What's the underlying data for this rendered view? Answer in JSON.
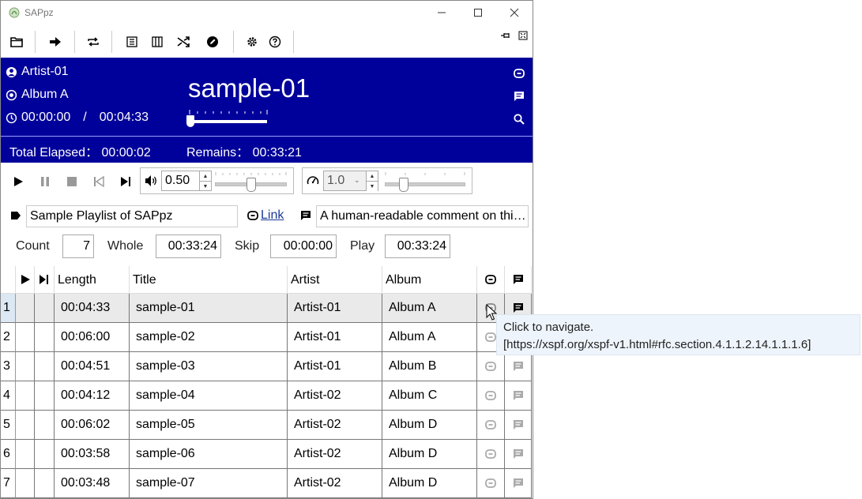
{
  "window": {
    "title": "SAPpz"
  },
  "window_controls": {
    "minimize": "—",
    "maximize": "☐",
    "close": "✕"
  },
  "toolbar": {
    "icons": [
      "folder-icon",
      "arrow-right-icon",
      "repeat-icon",
      "list-icon",
      "columns-icon",
      "shuffle-icon",
      "edit-icon",
      "gear-icon",
      "help-icon",
      "pin-icon",
      "fullscreen-icon"
    ]
  },
  "now_playing": {
    "artist": "Artist-01",
    "album": "Album A",
    "current_time": "00:00:00",
    "separator": "/",
    "total_time": "00:04:33",
    "title": "sample-01",
    "progress": 0.0
  },
  "elapsed": {
    "label": "Total Elapsed：",
    "value": "00:00:02"
  },
  "remains": {
    "label": "Remains：",
    "value": "00:33:21"
  },
  "volume": {
    "value": "0.50",
    "level": 0.5
  },
  "speed": {
    "value": "1.0",
    "level": 0.2
  },
  "playlist": {
    "title": "Sample Playlist of SAPpz",
    "link_label": "Link",
    "comment": "A human-readable comment on this playlist."
  },
  "stats": {
    "count_label": "Count",
    "count": "7",
    "whole_label": "Whole",
    "whole": "00:33:24",
    "skip_label": "Skip",
    "skip": "00:00:00",
    "play_label": "Play",
    "play": "00:33:24"
  },
  "table": {
    "columns": {
      "length": "Length",
      "title": "Title",
      "artist": "Artist",
      "album": "Album"
    },
    "rows": [
      {
        "num": "1",
        "length": "00:04:33",
        "title": "sample-01",
        "artist": "Artist-01",
        "album": "Album A"
      },
      {
        "num": "2",
        "length": "00:06:00",
        "title": "sample-02",
        "artist": "Artist-01",
        "album": "Album A"
      },
      {
        "num": "3",
        "length": "00:04:51",
        "title": "sample-03",
        "artist": "Artist-01",
        "album": "Album B"
      },
      {
        "num": "4",
        "length": "00:04:12",
        "title": "sample-04",
        "artist": "Artist-02",
        "album": "Album C"
      },
      {
        "num": "5",
        "length": "00:06:02",
        "title": "sample-05",
        "artist": "Artist-02",
        "album": "Album D"
      },
      {
        "num": "6",
        "length": "00:03:58",
        "title": "sample-06",
        "artist": "Artist-02",
        "album": "Album D"
      },
      {
        "num": "7",
        "length": "00:03:48",
        "title": "sample-07",
        "artist": "Artist-02",
        "album": "Album D"
      }
    ]
  },
  "tooltip": {
    "line1": "Click to navigate.",
    "line2": "[https://xspf.org/xspf-v1.html#rfc.section.4.1.1.2.14.1.1.1.6]"
  },
  "colors": {
    "header_bg": "#00009a",
    "selected_row": "#eaeaea",
    "tooltip_bg": "#eef4fb"
  }
}
